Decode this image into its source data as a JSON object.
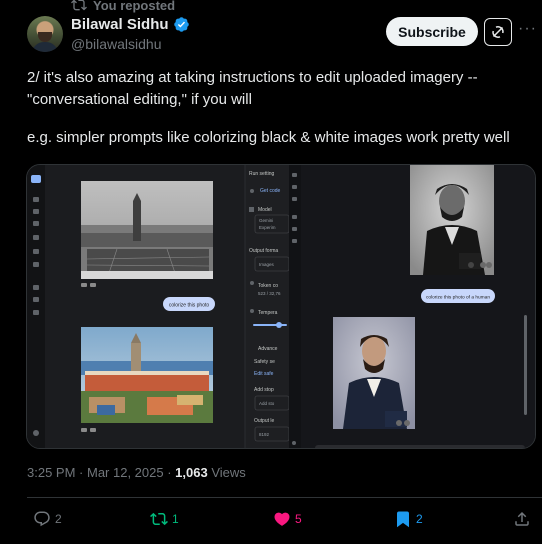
{
  "repost_banner": {
    "text": "You reposted",
    "icon": "repost-icon"
  },
  "author": {
    "display_name": "Bilawal Sidhu",
    "handle": "@bilawalsidhu",
    "verified": true
  },
  "header_actions": {
    "subscribe_label": "Subscribe",
    "grok_icon": "grok-icon",
    "more_icon": "more-icon",
    "more_glyph": "···"
  },
  "tweet": {
    "line1": "2/ it's also amazing at taking instructions to edit uploaded imagery --",
    "line2": "\"conversational editing,\" if you will",
    "line3": "e.g. simpler prompts like colorizing black & white images work pretty well"
  },
  "media": {
    "left_panel": {
      "prompt_bubble": "colorize this photo",
      "settings_title": "Run setting",
      "get_code": "Get code",
      "model_label": "Model",
      "model_value_1": "Gemini",
      "model_value_2": "Experim",
      "output_format_label": "Output forma",
      "output_format_value": "Images",
      "token_count_label": "Token co",
      "token_count_value": "523 / 32,76",
      "temperature_label": "Tempera",
      "advanced_label": "Advance",
      "safety_label": "Safety se",
      "edit_safety_label": "Edit safe",
      "add_stop_label": "Add stop",
      "add_stop_placeholder": "Add sto",
      "output_length_label": "Output le",
      "output_length_value": "8192"
    },
    "right_panel": {
      "prompt_bubble": "colorize this photo of a human"
    }
  },
  "meta": {
    "time": "3:25 PM",
    "separator": " · ",
    "date": "Mar 12, 2025",
    "views_count": "1,063",
    "views_label": " Views"
  },
  "actions": {
    "replies": "2",
    "reposts": "1",
    "likes": "5",
    "bookmarks": "2"
  },
  "colors": {
    "accent_blue": "#1d9bf0",
    "repost_green": "#00ba7c",
    "like_pink": "#f91880",
    "muted": "#71767b"
  }
}
